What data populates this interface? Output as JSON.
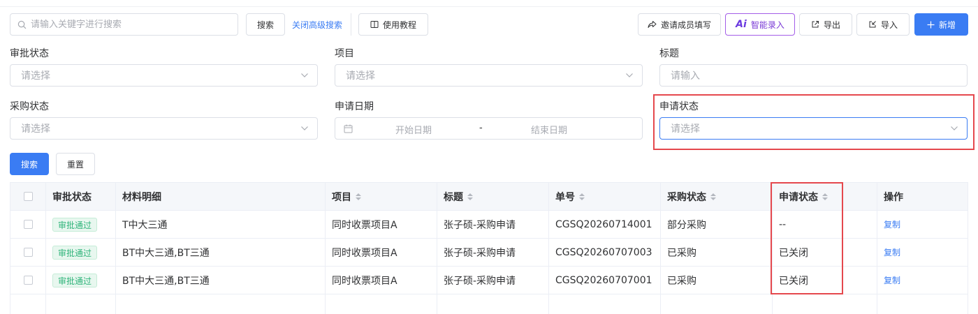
{
  "toolbar": {
    "search_placeholder": "请输入关键字进行搜索",
    "search_label": "搜索",
    "advanced_search_label": "关闭高级搜索",
    "tutorial_label": "使用教程",
    "invite_label": "邀请成员填写",
    "ai_mark": "Ai",
    "ai_entry_label": "智能录入",
    "export_label": "导出",
    "import_label": "导入",
    "add_label": "新增"
  },
  "filters": {
    "approval_status": {
      "label": "审批状态",
      "placeholder": "请选择"
    },
    "project": {
      "label": "项目",
      "placeholder": "请选择"
    },
    "title": {
      "label": "标题",
      "placeholder": "请输入"
    },
    "purchase_status": {
      "label": "采购状态",
      "placeholder": "请选择"
    },
    "apply_date": {
      "label": "申请日期",
      "start_placeholder": "开始日期",
      "separator": "-",
      "end_placeholder": "结束日期"
    },
    "apply_status": {
      "label": "申请状态",
      "placeholder": "请选择"
    },
    "search_label": "搜索",
    "reset_label": "重置"
  },
  "table": {
    "headers": {
      "approval_status": "审批状态",
      "material": "材料明细",
      "project": "项目",
      "title": "标题",
      "number": "单号",
      "purchase_status": "采购状态",
      "apply_status": "申请状态",
      "action": "操作"
    },
    "rows": [
      {
        "approval_status": "审批通过",
        "material": "T中大三通",
        "project": "同时收票项目A",
        "title": "张子硕-采购申请",
        "number": "CGSQ20260714001",
        "purchase_status": "部分采购",
        "apply_status": "--",
        "action": "复制"
      },
      {
        "approval_status": "审批通过",
        "material": "BT中大三通,BT三通",
        "project": "同时收票项目A",
        "title": "张子硕-采购申请",
        "number": "CGSQ20260707003",
        "purchase_status": "已采购",
        "apply_status": "已关闭",
        "action": "复制"
      },
      {
        "approval_status": "审批通过",
        "material": "BT中大三通,BT三通",
        "project": "同时收票项目A",
        "title": "张子硕-采购申请",
        "number": "CGSQ20260707001",
        "purchase_status": "已采购",
        "apply_status": "已关闭",
        "action": "复制"
      }
    ]
  },
  "colors": {
    "primary": "#3a7cf3",
    "highlight": "#e5484d",
    "approved_tag": "#2fb47a",
    "ai_accent": "#a35de8"
  }
}
